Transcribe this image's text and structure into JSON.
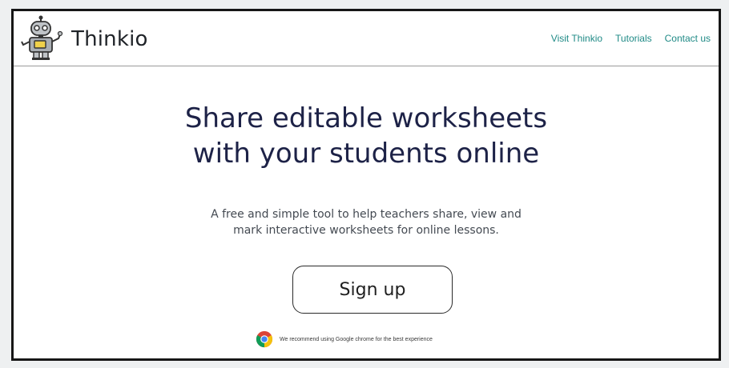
{
  "header": {
    "brand": "Thinkio",
    "logo_icon": "robot-icon",
    "nav": [
      {
        "label": "Visit Thinkio"
      },
      {
        "label": "Tutorials"
      },
      {
        "label": "Contact us"
      }
    ]
  },
  "hero": {
    "title_line1": "Share editable worksheets",
    "title_line2": "with your students online",
    "subtitle_line1": "A free and simple tool to help teachers share, view and",
    "subtitle_line2": "mark interactive worksheets for online lessons.",
    "cta_label": "Sign up"
  },
  "recommend": {
    "icon": "chrome-icon",
    "text": "We recommend using Google chrome for the best experience"
  },
  "colors": {
    "title": "#1d2247",
    "nav_link": "#1f8a86",
    "frame_border": "#161616"
  }
}
